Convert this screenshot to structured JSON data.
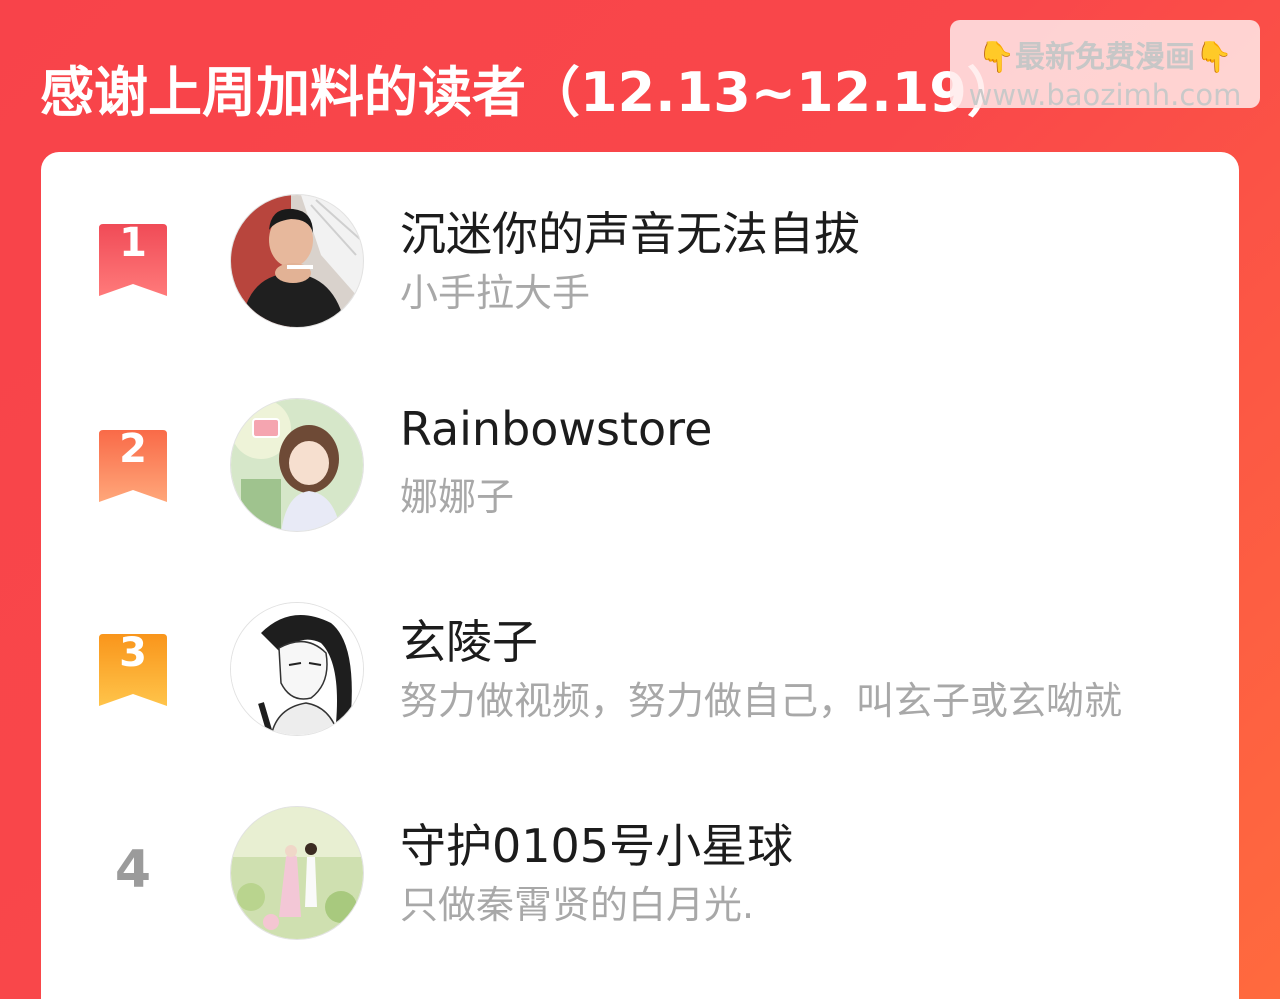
{
  "header": {
    "title": "感谢上周加料的读者（12.13~12.19）"
  },
  "watermark": {
    "line1_emoji_left": "👇",
    "line1_text": "最新免费漫画",
    "line1_emoji_right": "👇",
    "line2": "www.baozimh.com"
  },
  "readers": [
    {
      "rank": "1",
      "rank_color": "#f25a61",
      "name": "沉迷你的声音无法自拔",
      "subtitle": "小手拉大手",
      "avatar_icon": "avatar-photo-man-with-fan"
    },
    {
      "rank": "2",
      "rank_color": "#fb7a55",
      "name": "Rainbowstore",
      "subtitle": "娜娜子",
      "avatar_icon": "avatar-anime-girl"
    },
    {
      "rank": "3",
      "rank_color": "#fba21f",
      "name": "玄陵子",
      "subtitle": "努力做视频，努力做自己，叫玄子或玄呦就",
      "avatar_icon": "avatar-ink-drawing-boy"
    },
    {
      "rank": "4",
      "rank_color": "#9b9b9b",
      "name": "守护0105号小星球",
      "subtitle": "只做秦霄贤的白月光.",
      "avatar_icon": "avatar-garden-couple"
    }
  ]
}
